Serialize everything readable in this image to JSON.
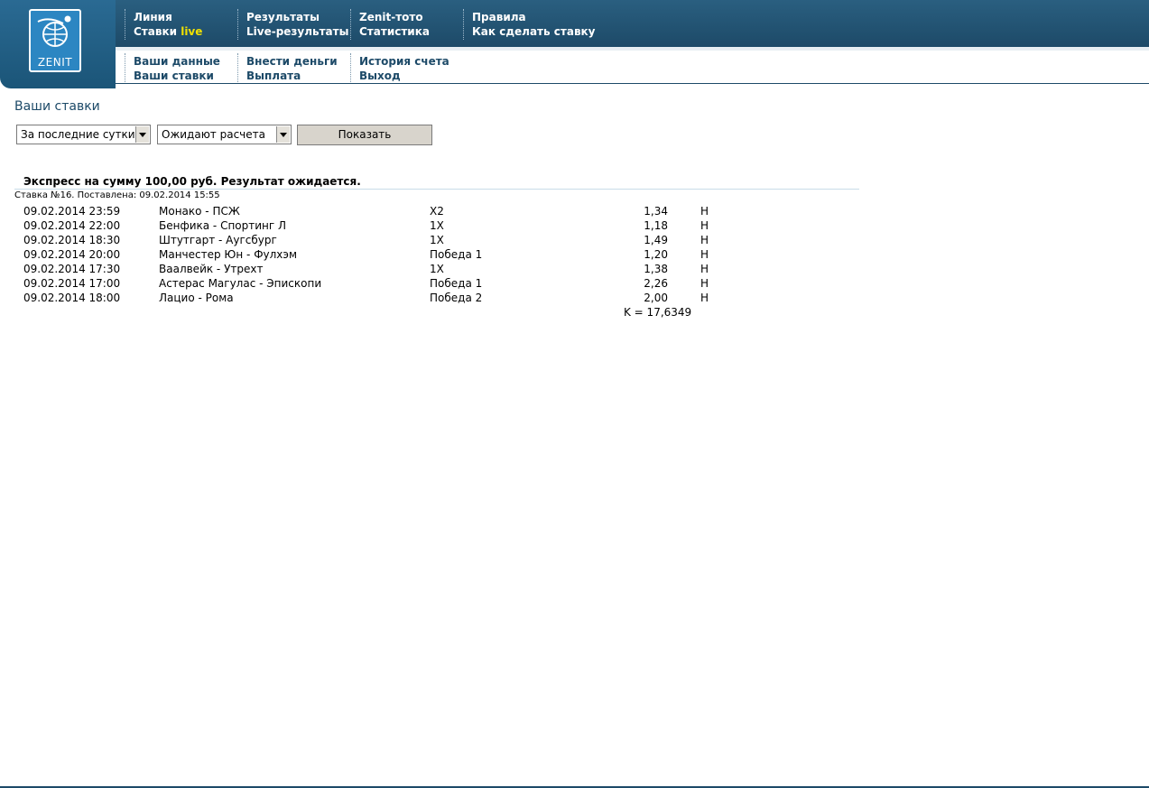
{
  "brand": {
    "logo_text": "ZENIT"
  },
  "top_nav": [
    {
      "links": [
        "Линия",
        "Ставки"
      ],
      "live_suffix": "live"
    },
    {
      "links": [
        "Результаты",
        "Live-результаты"
      ]
    },
    {
      "links": [
        "Zenit-тото",
        "Статистика"
      ]
    },
    {
      "links": [
        "Правила",
        "Как сделать ставку"
      ]
    }
  ],
  "account_nav": [
    {
      "links": [
        "Ваши данные",
        "Ваши ставки"
      ]
    },
    {
      "links": [
        "Внести деньги",
        "Выплата"
      ]
    },
    {
      "links": [
        "История счета",
        "Выход"
      ]
    }
  ],
  "page": {
    "title": "Ваши ставки",
    "filters": {
      "period": "За последние сутки",
      "status": "Ожидают расчета",
      "show_button": "Показать"
    }
  },
  "bet": {
    "header": "Экспресс на сумму 100,00 руб.  Результат ожидается.",
    "info": "Ставка №16. Поставлена: 09.02.2014 15:55",
    "rows": [
      {
        "date": "09.02.2014 23:59",
        "match": "Монако - ПСЖ",
        "outcome": "X2",
        "coef": "1,34",
        "status": "Н"
      },
      {
        "date": "09.02.2014 22:00",
        "match": "Бенфика - Спортинг Л",
        "outcome": "1X",
        "coef": "1,18",
        "status": "Н"
      },
      {
        "date": "09.02.2014 18:30",
        "match": "Штутгарт - Аугсбург",
        "outcome": "1X",
        "coef": "1,49",
        "status": "Н"
      },
      {
        "date": "09.02.2014 20:00",
        "match": "Манчестер Юн - Фулхэм",
        "outcome": "Победа 1",
        "coef": "1,20",
        "status": "Н"
      },
      {
        "date": "09.02.2014 17:30",
        "match": "Ваалвейк - Утрехт",
        "outcome": "1X",
        "coef": "1,38",
        "status": "Н"
      },
      {
        "date": "09.02.2014 17:00",
        "match": "Астерас Магулас - Эпископи",
        "outcome": "Победа 1",
        "coef": "2,26",
        "status": "Н"
      },
      {
        "date": "09.02.2014 18:00",
        "match": "Лацио - Рома",
        "outcome": "Победа 2",
        "coef": "2,00",
        "status": "Н"
      }
    ],
    "total": "K = 17,6349"
  }
}
